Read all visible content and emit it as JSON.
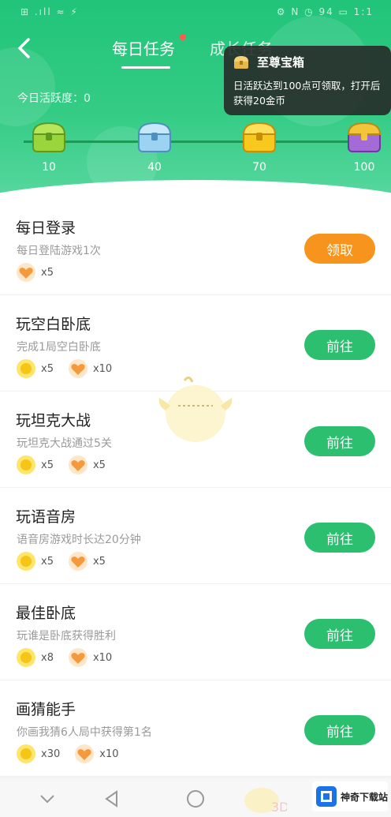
{
  "status_bar": {
    "left_text": "⊞ .ıll ≈ ⚡",
    "right_text": "⚙ N ◷ 94 ▭ 1:1"
  },
  "header": {
    "back_label": "‹",
    "tabs": [
      {
        "label": "每日任务",
        "active": true
      },
      {
        "label": "成长任务",
        "active": false
      }
    ],
    "activity_label": "今日活跃度：0"
  },
  "progress": {
    "milestones": [
      {
        "points": "10",
        "chest": "green-chest-icon"
      },
      {
        "points": "40",
        "chest": "blue-chest-icon"
      },
      {
        "points": "70",
        "chest": "gold-chest-icon"
      },
      {
        "points": "100",
        "chest": "purple-chest-icon"
      }
    ]
  },
  "tooltip": {
    "title": "至尊宝箱",
    "description": "日活跃达到100点可领取，打开后获得20金币"
  },
  "tasks": [
    {
      "title": "每日登录",
      "desc": "每日登陆游戏1次",
      "rewards": [
        {
          "icon": "heart-icon",
          "count": "x5"
        }
      ],
      "button": "领取",
      "claim": true
    },
    {
      "title": "玩空白卧底",
      "desc": "完成1局空白卧底",
      "rewards": [
        {
          "icon": "coin-icon",
          "count": "x5"
        },
        {
          "icon": "heart-icon",
          "count": "x10"
        }
      ],
      "button": "前往",
      "claim": false
    },
    {
      "title": "玩坦克大战",
      "desc": "玩坦克大战通过5关",
      "rewards": [
        {
          "icon": "coin-icon",
          "count": "x5"
        },
        {
          "icon": "heart-icon",
          "count": "x5"
        }
      ],
      "button": "前往",
      "claim": false
    },
    {
      "title": "玩语音房",
      "desc": "语音房游戏时长达20分钟",
      "rewards": [
        {
          "icon": "coin-icon",
          "count": "x5"
        },
        {
          "icon": "heart-icon",
          "count": "x5"
        }
      ],
      "button": "前往",
      "claim": false
    },
    {
      "title": "最佳卧底",
      "desc": "玩谁是卧底获得胜利",
      "rewards": [
        {
          "icon": "coin-icon",
          "count": "x8"
        },
        {
          "icon": "heart-icon",
          "count": "x10"
        }
      ],
      "button": "前往",
      "claim": false
    },
    {
      "title": "画猜能手",
      "desc": "你画我猜6人局中获得第1名",
      "rewards": [
        {
          "icon": "coin-icon",
          "count": "x30"
        },
        {
          "icon": "heart-icon",
          "count": "x10"
        }
      ],
      "button": "前往",
      "claim": false
    }
  ],
  "watermark": {
    "text": "神奇下载站"
  },
  "colors": {
    "green": "#2bbf6f",
    "orange": "#f7941e",
    "header_green": "#21c47a"
  }
}
